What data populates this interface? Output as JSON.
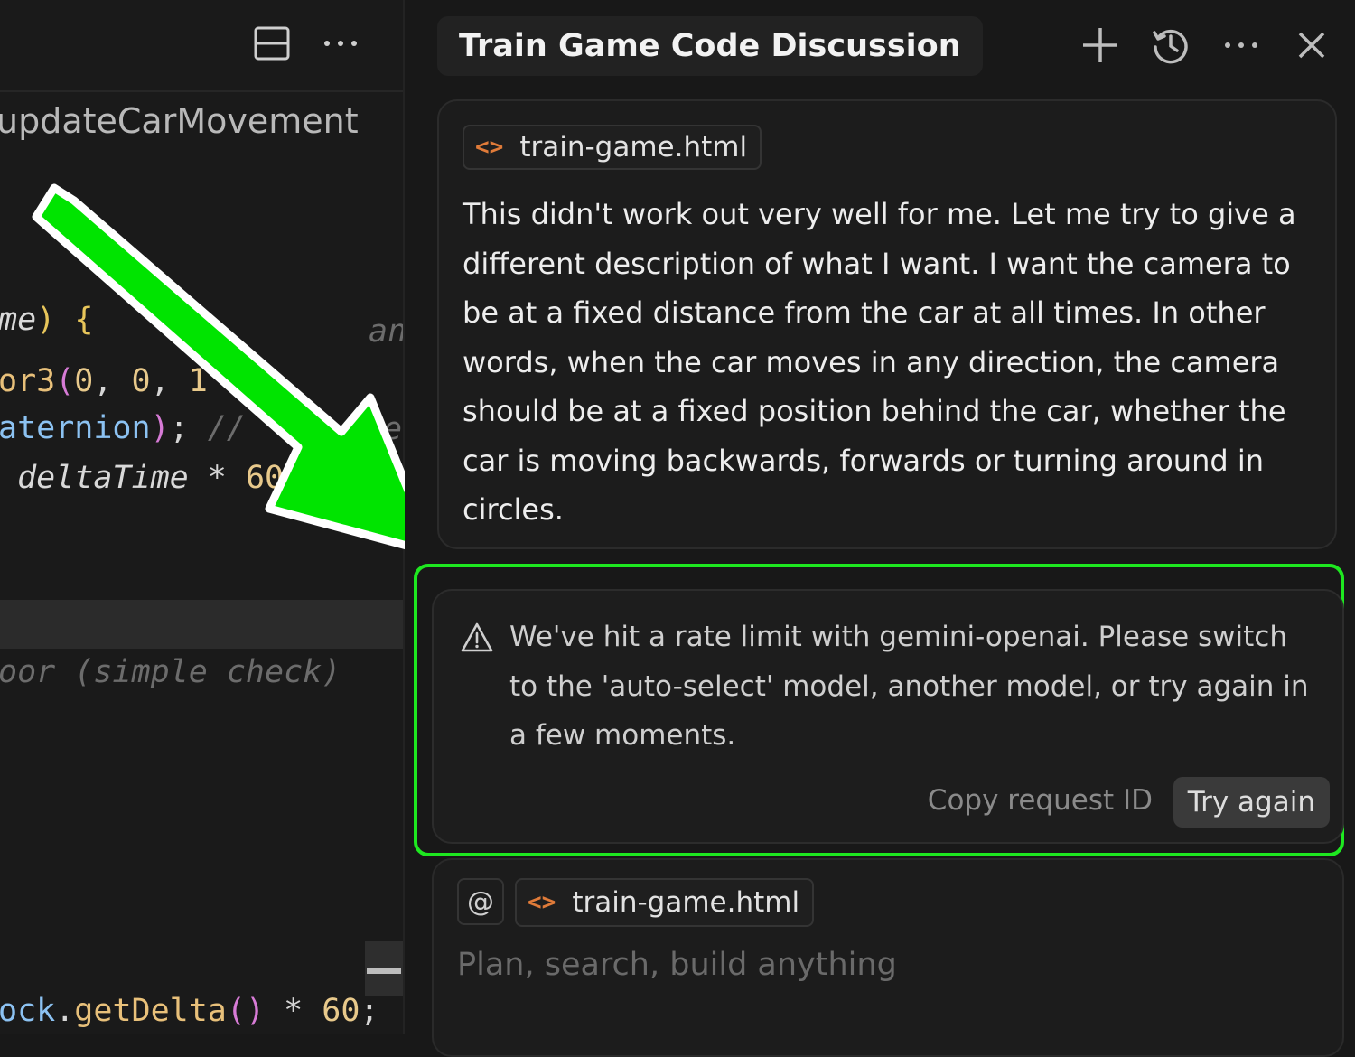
{
  "editor": {
    "breadcrumb": "updateCarMovement",
    "code_lines": [
      {
        "segments": [
          {
            "t": "me",
            "c": "c-param"
          },
          {
            "t": ") ",
            "c": "c-yellow"
          },
          {
            "t": "{",
            "c": "c-yellow"
          }
        ]
      },
      {
        "segments": [
          {
            "t": "or3",
            "c": "c-method"
          },
          {
            "t": "(",
            "c": "c-pink"
          },
          {
            "t": "0",
            "c": "c-num"
          },
          {
            "t": ", ",
            "c": "c-white"
          },
          {
            "t": "0",
            "c": "c-num"
          },
          {
            "t": ", ",
            "c": "c-white"
          },
          {
            "t": "1",
            "c": "c-num"
          }
        ]
      },
      {
        "segments": [
          {
            "t": "aternion",
            "c": "c-blue"
          },
          {
            "t": ")",
            "c": "c-pink"
          },
          {
            "t": "; ",
            "c": "c-white"
          },
          {
            "t": "// ",
            "c": "c-comment"
          }
        ]
      },
      {
        "segments": [
          {
            "t": " deltaTime",
            "c": "c-param"
          },
          {
            "t": " * ",
            "c": "c-white"
          },
          {
            "t": "60",
            "c": "c-num"
          }
        ]
      }
    ],
    "floating_comment_1": "an",
    "floating_comment_2": "e",
    "comment_line": "oor (simple check)",
    "last_line": [
      {
        "t": "ock",
        "c": "c-blue"
      },
      {
        "t": ".",
        "c": "c-white"
      },
      {
        "t": "getDelta",
        "c": "c-method"
      },
      {
        "t": "()",
        "c": "c-pink"
      },
      {
        "t": " * ",
        "c": "c-white"
      },
      {
        "t": "60",
        "c": "c-num"
      },
      {
        "t": ";",
        "c": "c-white"
      }
    ]
  },
  "chat": {
    "title": "Train Game Code Discussion",
    "message": {
      "file_chip": "train-game.html",
      "text": "This didn't work out very well for me. Let me try to give a different description of what I want. I want the camera to be at a fixed distance from the car at all times. In other words, when the car moves in any direction, the camera should be at a fixed position behind the car, whether the car is moving backwards, forwards or turning around in circles."
    },
    "error": {
      "text": "We've hit a rate limit with gemini-openai. Please switch to the 'auto-select' model, another model, or try again in a few moments.",
      "copy_label": "Copy request ID",
      "retry_label": "Try again"
    },
    "composer": {
      "at_symbol": "@",
      "file_chip": "train-game.html",
      "placeholder": "Plan, search, build anything"
    }
  },
  "icons": {
    "layout": "layout-split-icon",
    "more": "more-horizontal-icon",
    "add": "plus-icon",
    "history": "history-icon",
    "close": "close-icon",
    "file": "code-file-icon",
    "warning": "warning-icon"
  },
  "colors": {
    "highlight_green": "#1ee820",
    "arrow_green": "#00e400",
    "code_icon_orange": "#e07b39"
  }
}
